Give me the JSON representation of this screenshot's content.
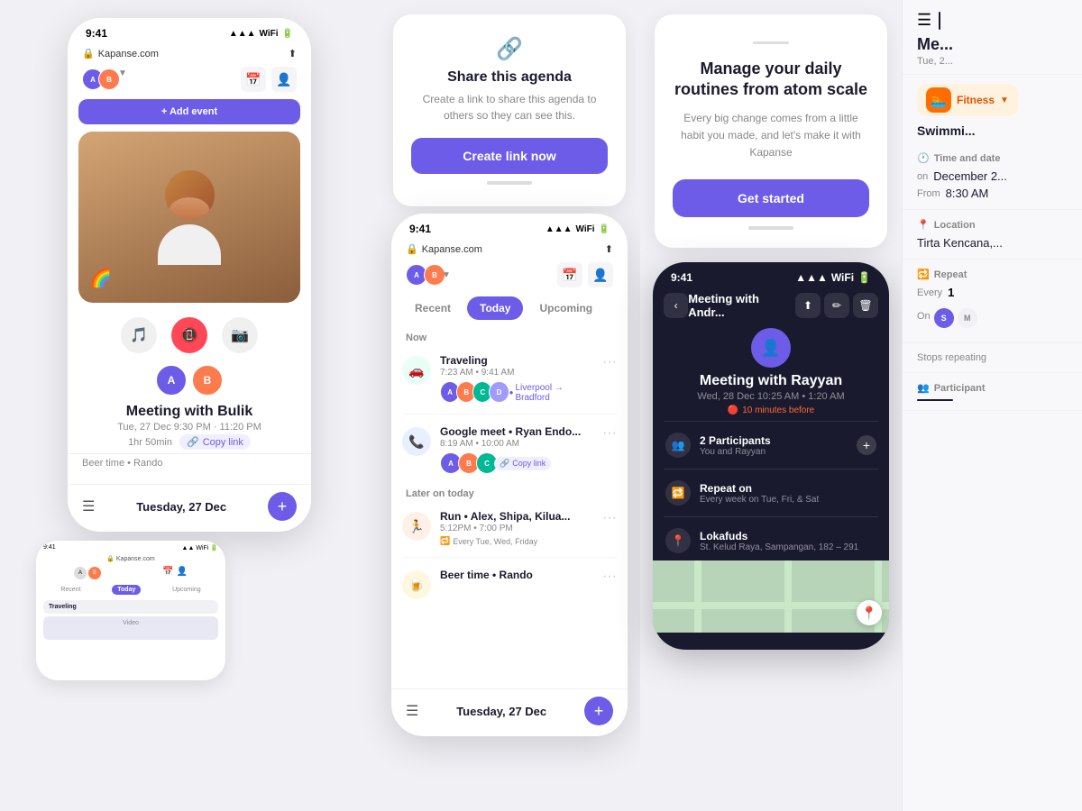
{
  "app": {
    "name": "Kapanse",
    "url": "Kapanse.com"
  },
  "statusBar": {
    "time": "9:41",
    "signal": "▲▲▲",
    "wifi": "WiFi",
    "battery": "🔋"
  },
  "phone1": {
    "title": "Meeting with Bulik",
    "date": "Tue, 27 Dec",
    "time": "9:30 PM",
    "end_time": "11:20 PM",
    "duration": "1hr 50min",
    "copy_link": "Copy link",
    "beer_preview": "Beer time • Rando",
    "bottom_date": "Tuesday, 27 Dec",
    "plus_label": "+",
    "hamburger": "☰"
  },
  "shareCard": {
    "title": "Share this agenda",
    "description": "Create a link to share this agenda to others so they can see this.",
    "button": "Create link now",
    "icon": "🔗"
  },
  "calendarPhone": {
    "time": "9:41",
    "url": "Kapanse.com",
    "tabs": {
      "recent": "Recent",
      "today": "Today",
      "upcoming": "Upcoming"
    },
    "now_label": "Now",
    "later_label": "Later on today",
    "events": [
      {
        "title": "Traveling",
        "time": "7:23 AM • 9:41 AM",
        "location": "Liverpool → Bradford",
        "icon": "🚗"
      },
      {
        "title": "Google meet • Ryan Endo...",
        "time": "8:19 AM • 10:00 AM",
        "copy_link": "Copy link",
        "icon": "📞"
      },
      {
        "title": "Run • Alex, Shipa, Kilua...",
        "time": "5:12PM • 7:00 PM",
        "repeat": "Every Tue, Wed, Friday",
        "icon": "🏃"
      },
      {
        "title": "Beer time • Rando",
        "time": "",
        "icon": "🍺"
      }
    ],
    "bottom_date": "Tuesday, 27 Dec",
    "plus_label": "+",
    "hamburger": "☰"
  },
  "landingCard": {
    "title": "Manage your daily routines from atom scale",
    "description": "Every big change comes from a little habit you made, and let's make it with Kapanse",
    "button": "Get started"
  },
  "darkPhone": {
    "time": "9:41",
    "event_title": "Meeting with Andr...",
    "meeting_title": "Meeting with Rayyan",
    "meeting_date": "Wed, 28 Dec",
    "meeting_time": "10:25 AM • 1:20 AM",
    "alert": "10 minutes before",
    "participants": {
      "label": "2 Participants",
      "sub": "You and Rayyan"
    },
    "repeat_on": {
      "label": "Repeat on",
      "value": "Every week on Tue, Fri, & Sat"
    },
    "location": {
      "label": "Lokafuds",
      "address": "St. Kelud Raya, Sampangan, 182 – 291"
    }
  },
  "rightPanel": {
    "prefix": "Me...",
    "date": "Tue, 2...",
    "fitness_tag": "Fitness",
    "event_name": "Swimmi...",
    "time_date_label": "Time and date",
    "date_label": "on",
    "date_value": "December 2...",
    "from_label": "From",
    "from_value": "8:30 AM",
    "location_label": "Location",
    "location_value": "Tirta Kencana,...",
    "repeat_label": "Repeat",
    "every_label": "Every",
    "every_value": "1",
    "on_label": "On",
    "days": [
      "S",
      "M"
    ],
    "stops_repeating": "Stops repeating",
    "participant_label": "Participant"
  },
  "phone2Small": {
    "time": "9:41",
    "url": "Kapanse.com",
    "event_tag": "Today",
    "event1": "Traveling",
    "upcoming_tab": "Upcoming"
  }
}
